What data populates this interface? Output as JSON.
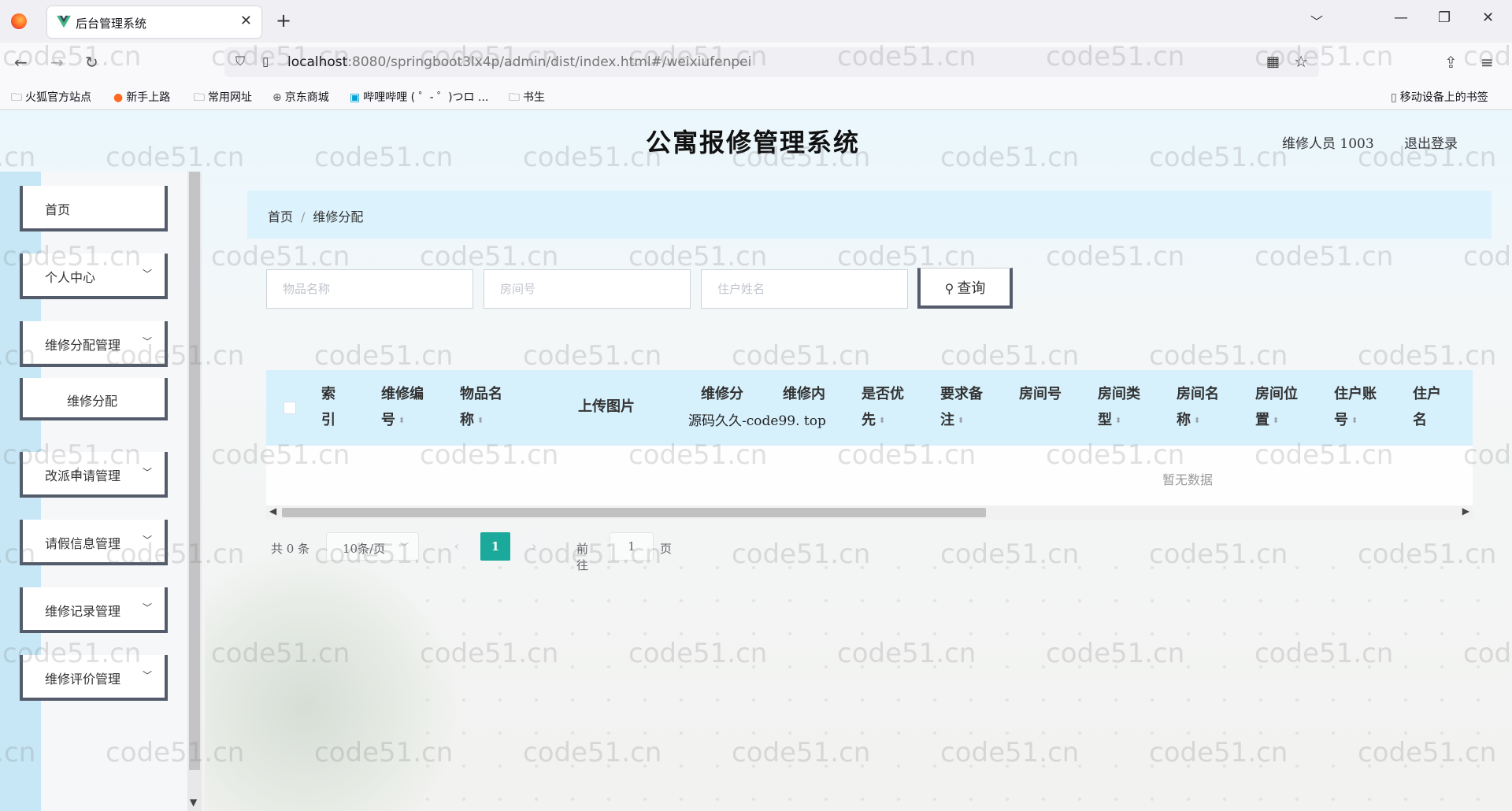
{
  "browser": {
    "tab_title": "后台管理系统",
    "url_host": "localhost",
    "url_rest": ":8080/springboot3lx4p/admin/dist/index.html#/weixiufenpei",
    "bookmarks": [
      "火狐官方站点",
      "新手上路",
      "常用网址",
      "京东商城",
      "哔哩哔哩 ( ゜- ゜)つロ ...",
      "书生"
    ],
    "mobile_bookmarks": "移动设备上的书签"
  },
  "header": {
    "title": "公寓报修管理系统",
    "user": "维修人员 1003",
    "logout": "退出登录"
  },
  "sidebar": {
    "items": [
      {
        "label": "首页"
      },
      {
        "label": "个人中心"
      },
      {
        "label": "维修分配管理"
      },
      {
        "label": "维修分配"
      },
      {
        "label": "改派申请管理"
      },
      {
        "label": "请假信息管理"
      },
      {
        "label": "维修记录管理"
      },
      {
        "label": "维修评价管理"
      }
    ]
  },
  "breadcrumb": {
    "home": "首页",
    "sep": "/",
    "current": "维修分配"
  },
  "search": {
    "item_placeholder": "物品名称",
    "room_placeholder": "房间号",
    "resident_placeholder": "住户姓名",
    "button": "查询"
  },
  "table": {
    "columns": [
      {
        "l1": "索",
        "l2": "引"
      },
      {
        "l1": "维修编",
        "l2": "号"
      },
      {
        "l1": "物品名",
        "l2": "称"
      },
      {
        "l1": "上传图片",
        "l2": ""
      },
      {
        "l1": "维修分",
        "l2": ""
      },
      {
        "l1": "维修内",
        "l2": ""
      },
      {
        "l1": "是否优",
        "l2": "先"
      },
      {
        "l1": "要求备",
        "l2": "注"
      },
      {
        "l1": "房间号",
        "l2": ""
      },
      {
        "l1": "房间类",
        "l2": "型"
      },
      {
        "l1": "房间名",
        "l2": "称"
      },
      {
        "l1": "房间位",
        "l2": "置"
      },
      {
        "l1": "住户账",
        "l2": "号"
      },
      {
        "l1": "住户",
        "l2": "名"
      }
    ],
    "overlay_text": "源码久久-code99. top",
    "empty_text": "暂无数据"
  },
  "pagination": {
    "total": "共 0 条",
    "page_size": "10条/页",
    "current_page": "1",
    "goto": "前往",
    "goto_value": "1",
    "unit": "页"
  },
  "watermark": "code51.cn",
  "colors": {
    "accent": "#1aa99a",
    "header_bg": "#d6f0fc",
    "menu_border": "#545c6c"
  }
}
